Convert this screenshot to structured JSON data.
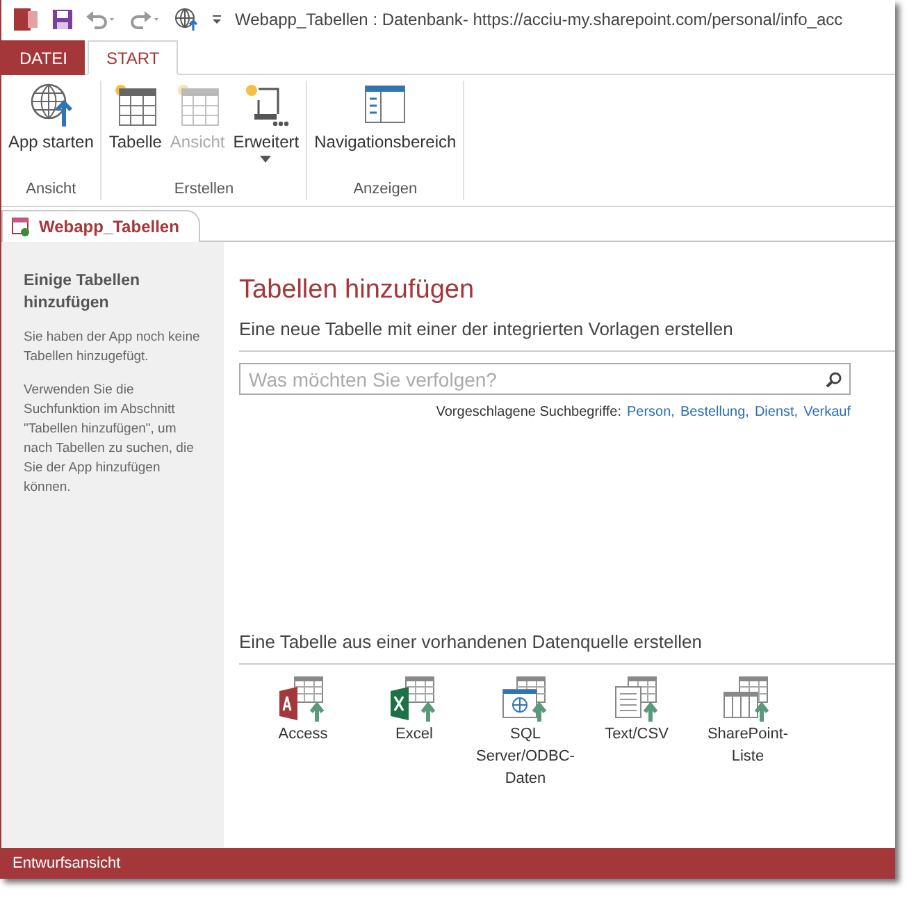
{
  "window": {
    "title": "Webapp_Tabellen : Datenbank- https://acciu-my.sharepoint.com/personal/info_acc"
  },
  "ribbon_tabs": [
    {
      "label": "DATEI",
      "kind": "file",
      "selected": false
    },
    {
      "label": "START",
      "kind": "tab",
      "selected": true
    }
  ],
  "ribbon_groups": [
    {
      "label": "Ansicht",
      "buttons": [
        {
          "label": "App starten",
          "kind": "globe",
          "disabled": false,
          "dropdown": false
        }
      ]
    },
    {
      "label": "Erstellen",
      "buttons": [
        {
          "label": "Tabelle",
          "kind": "table",
          "disabled": false,
          "dropdown": false
        },
        {
          "label": "Ansicht",
          "kind": "view",
          "disabled": true,
          "dropdown": false
        },
        {
          "label": "Erweitert",
          "kind": "advanced",
          "disabled": false,
          "dropdown": true
        }
      ]
    },
    {
      "label": "Anzeigen",
      "buttons": [
        {
          "label": "Navigationsbereich",
          "kind": "nav",
          "disabled": false,
          "dropdown": false
        }
      ]
    }
  ],
  "document_tab": {
    "label": "Webapp_Tabellen"
  },
  "sidebar": {
    "title": "Einige Tabellen hinzufügen",
    "paragraphs": [
      "Sie haben der App noch keine Tabellen hinzugefügt.",
      "Verwenden Sie die Suchfunktion im Abschnitt \"Tabellen hinzufügen\", um nach Tabellen zu suchen, die Sie der App hinzufügen können."
    ]
  },
  "main": {
    "heading": "Tabellen hinzufügen",
    "template_section": "Eine neue Tabelle mit einer der integrierten Vorlagen erstellen",
    "search": {
      "placeholder": "Was möchten Sie verfolgen?"
    },
    "suggestions_label": "Vorgeschlagene Suchbegriffe:",
    "suggestions": [
      "Person,",
      "Bestellung,",
      "Dienst,",
      "Verkauf"
    ],
    "source_section": "Eine Tabelle aus einer vorhandenen Datenquelle erstellen",
    "sources": [
      {
        "label": "Access",
        "kind": "access"
      },
      {
        "label": "Excel",
        "kind": "excel"
      },
      {
        "label": "SQL Server/ODBC-Daten",
        "kind": "sql"
      },
      {
        "label": "Text/CSV",
        "kind": "text"
      },
      {
        "label": "SharePoint-Liste",
        "kind": "sharepoint"
      }
    ]
  },
  "status_bar": {
    "text": "Entwurfsansicht"
  }
}
